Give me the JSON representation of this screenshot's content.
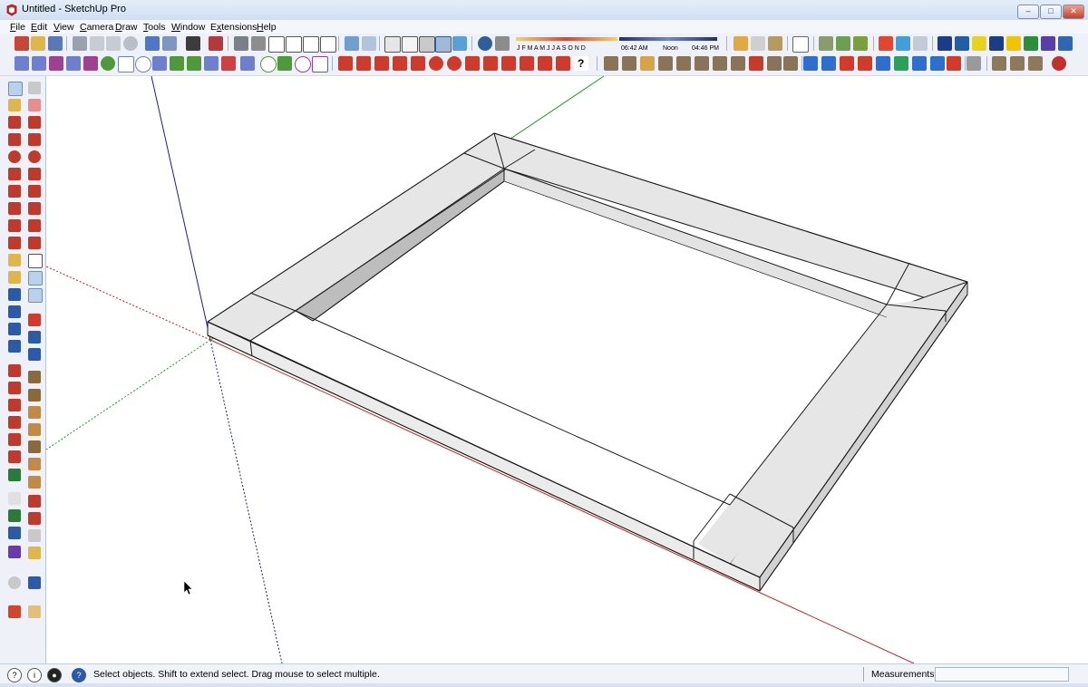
{
  "window": {
    "title": "Untitled - SketchUp Pro",
    "minimize": "‒",
    "maximize": "□",
    "close": "✕"
  },
  "menu": [
    {
      "label": "File",
      "accel": "F"
    },
    {
      "label": "Edit",
      "accel": "E"
    },
    {
      "label": "View",
      "accel": "V"
    },
    {
      "label": "Camera",
      "accel": "C"
    },
    {
      "label": "Draw",
      "accel": "D"
    },
    {
      "label": "Tools",
      "accel": "T"
    },
    {
      "label": "Window",
      "accel": "W"
    },
    {
      "label": "Extensions",
      "accel": "x"
    },
    {
      "label": "Help",
      "accel": "H"
    }
  ],
  "shadow": {
    "months": "J F M A M J J A S O N D",
    "time_start": "06:42 AM",
    "time_mid": "Noon",
    "time_end": "04:46 PM"
  },
  "status": {
    "hint": "Select objects. Shift to extend select. Drag mouse to select multiple.",
    "info_icon": "i",
    "measurements_label": "Measurements",
    "measurements_value": ""
  },
  "colors": {
    "axis_red": "#d02020",
    "axis_green": "#1a9e1a",
    "axis_blue": "#1a1aa8",
    "face_top": "#e6e6e6",
    "face_side": "#d2d2d2",
    "edge": "#1a1a1a",
    "selected_tool": "#b9d1ea"
  },
  "icons": {
    "app": "sketchup-logo-icon",
    "cursor": "arrow-cursor-icon"
  }
}
